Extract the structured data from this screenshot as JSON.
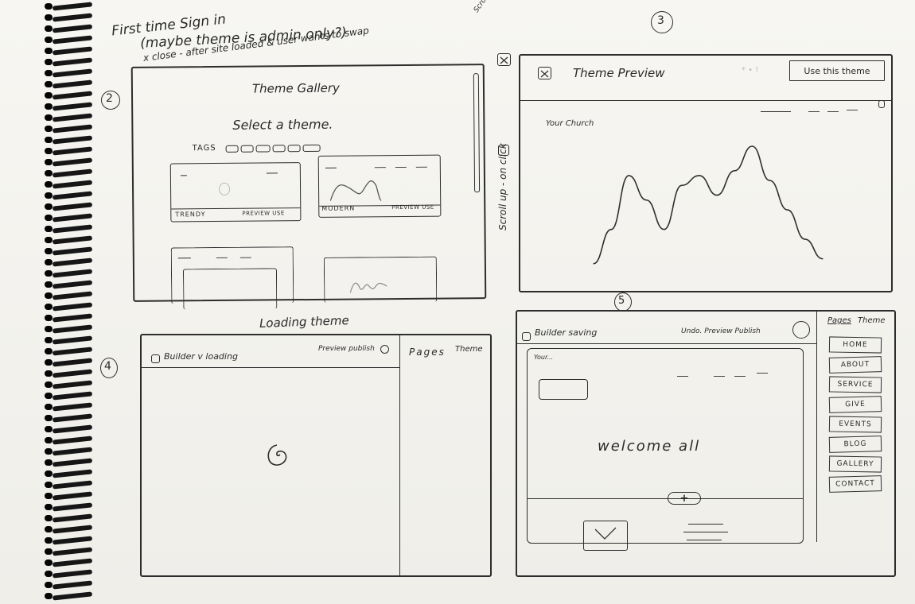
{
  "top_notes": {
    "line1": "First time Sign in",
    "line2": "(maybe theme is admin only?)",
    "line3": "x close - after site loaded & user wants to swap",
    "side_note": "Scroll down to preview previous page",
    "vertical_note": "Scroll up - on click"
  },
  "gallery": {
    "step": "2",
    "title": "Theme Gallery",
    "subtitle": "Select a theme.",
    "tags_label": "TAGS",
    "card1_labels": [
      "TRENDY",
      "PREVIEW USE"
    ],
    "card2_labels": [
      "MODERN",
      "PREVIEW USE"
    ]
  },
  "preview": {
    "step": "3",
    "close_icon": "x-close-icon",
    "title": "Theme Preview",
    "use_button": "Use this theme",
    "church_label": "Your Church",
    "chart_data": {
      "type": "line",
      "x": [
        0,
        1,
        2,
        3,
        4,
        5,
        6,
        7,
        8,
        9,
        10,
        11,
        12,
        13
      ],
      "values": [
        5,
        40,
        95,
        70,
        40,
        85,
        95,
        75,
        100,
        125,
        90,
        60,
        30,
        10
      ],
      "title": "",
      "xlabel": "",
      "ylabel": ""
    }
  },
  "loading": {
    "step": "4",
    "caption": "Loading theme",
    "builder_label": "Builder v loading",
    "preview_publish": "Preview publish",
    "pages_tab": "Pages",
    "theme_tab": "Theme"
  },
  "builder": {
    "step": "5",
    "builder_label": "Builder saving",
    "undo_preview_publish": "Undo. Preview Publish",
    "site_label": "Your...",
    "welcome": "welcome all",
    "add_button": "+",
    "pages_tab": "Pages",
    "theme_tab": "Theme",
    "pages": [
      "HOME",
      "ABOUT",
      "SERVICE",
      "GIVE",
      "EVENTS",
      "BLOG",
      "GALLERY",
      "CONTACT"
    ]
  }
}
